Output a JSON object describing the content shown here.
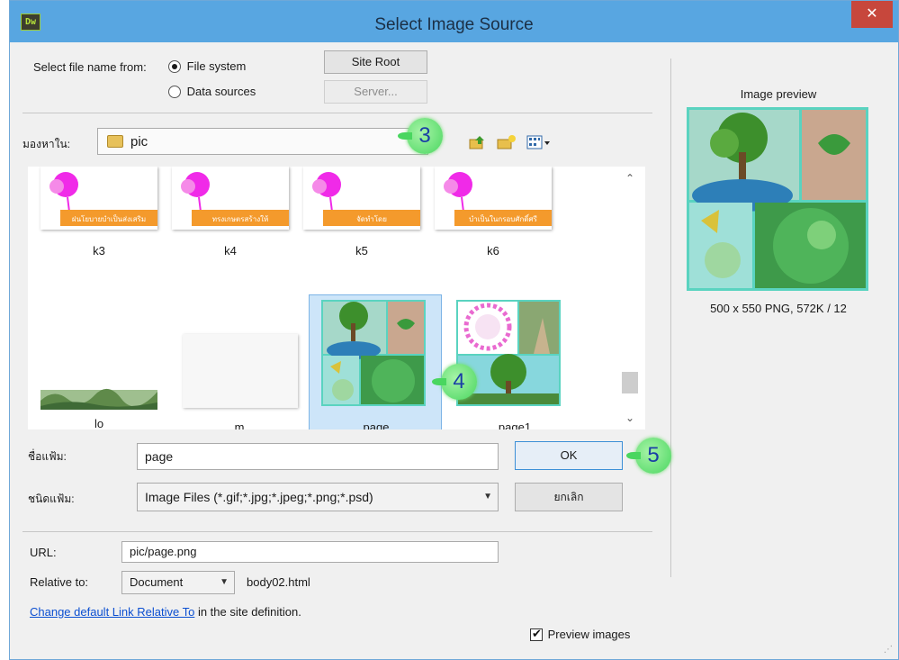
{
  "window": {
    "title": "Select Image Source",
    "app_icon_text": "Dw",
    "close_glyph": "✕"
  },
  "source": {
    "label": "Select file name from:",
    "options": [
      {
        "label": "File system",
        "checked": true
      },
      {
        "label": "Data sources",
        "checked": false
      }
    ],
    "site_root_label": "Site Root",
    "server_label": "Server..."
  },
  "lookin": {
    "label": "มองหาใน:",
    "folder": "pic"
  },
  "files": [
    {
      "name": "k3",
      "caption": "ฝนโยบายบำเป็นส่งเสริม"
    },
    {
      "name": "k4",
      "caption": "ทรงเกษตรสร้างให้"
    },
    {
      "name": "k5",
      "caption": "จัดทำโดย"
    },
    {
      "name": "k6",
      "caption": "บำเป็นในกรอบศักดิ์ศรี"
    },
    {
      "name": "lo"
    },
    {
      "name": "m"
    },
    {
      "name": "page",
      "selected": true
    },
    {
      "name": "page1"
    }
  ],
  "filename": {
    "label": "ชื่อแฟ้ม:",
    "value": "page"
  },
  "filetype": {
    "label": "ชนิดแฟ้ม:",
    "value": "Image Files (*.gif;*.jpg;*.jpeg;*.png;*.psd)"
  },
  "buttons": {
    "ok": "OK",
    "cancel": "ยกเลิก"
  },
  "url": {
    "label": "URL:",
    "value": "pic/page.png"
  },
  "relative": {
    "label": "Relative to:",
    "value": "Document",
    "file": "body02.html"
  },
  "link": {
    "text": "Change default Link Relative To",
    "suffix": "in the site definition."
  },
  "preview": {
    "title": "Image preview",
    "info": "500 x 550 PNG, 572K / 12",
    "checkbox_label": "Preview images",
    "checked": true
  },
  "annotations": {
    "step3": "3",
    "step4": "4",
    "step5": "5"
  },
  "colors": {
    "titlebar": "#58a6e1",
    "close": "#c7473c",
    "selection": "#cde5f9",
    "badge": "#49d65f"
  }
}
